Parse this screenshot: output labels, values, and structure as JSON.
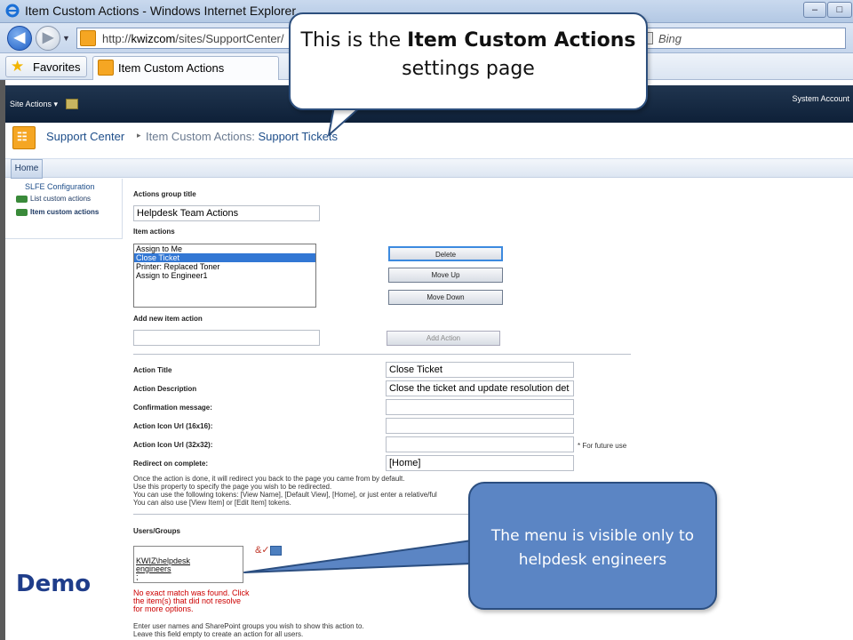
{
  "browser": {
    "window_title": "Item Custom Actions - Windows Internet Explorer",
    "address_prefix": "http://",
    "address_host": "kwizcom",
    "address_path": "/sites/SupportCenter/",
    "search_placeholder": "Bing",
    "favorites_label": "Favorites",
    "tab_title": "Item Custom Actions"
  },
  "sharepoint": {
    "site_actions": "Site Actions ▾",
    "user": "System Account",
    "breadcrumb": {
      "site": "Support Center",
      "page_prefix": "Item Custom Actions: ",
      "page_list": "Support Tickets"
    },
    "top_nav": {
      "home": "Home"
    },
    "quick_launch": {
      "heading": "SLFE Configuration",
      "items": [
        "List custom actions",
        "Item custom actions"
      ]
    }
  },
  "form": {
    "group_title_label": "Actions group title",
    "group_title_value": "Helpdesk Team Actions",
    "item_actions_label": "Item actions",
    "item_actions": [
      "Assign to Me",
      "Close Ticket",
      "Printer: Replaced Toner",
      "Assign to Engineer1"
    ],
    "selected_action": "Close Ticket",
    "buttons": {
      "delete": "Delete",
      "move_up": "Move Up",
      "move_down": "Move Down",
      "add_action": "Add Action"
    },
    "add_new_label": "Add new item action",
    "fields": {
      "action_title": {
        "label": "Action Title",
        "value": "Close Ticket"
      },
      "action_description": {
        "label": "Action Description",
        "value": "Close the ticket and update resolution det"
      },
      "confirmation": {
        "label": "Confirmation message:",
        "value": ""
      },
      "icon16": {
        "label": "Action Icon Url (16x16):",
        "value": ""
      },
      "icon32": {
        "label": "Action Icon Url (32x32):",
        "value": "",
        "note": "* For future use"
      },
      "redirect": {
        "label": "Redirect on complete:",
        "value": "[Home]"
      }
    },
    "redirect_help": [
      "Once the action is done, it will redirect you back to the page you came from by default.",
      "Use this property to specify the page you wish to be redirected.",
      "You can use the following tokens: [View Name], [Default View], [Home], or just enter a relative/ful",
      "You can also use [View Item] or [Edit Item] tokens."
    ],
    "users_groups_label": "Users/Groups",
    "people_value_line1": "KWIZ\\helpdesk",
    "people_value_line2": "engineers",
    "people_value_line3": ";",
    "error_lines": [
      "No exact match was found. Click",
      "the item(s) that did not resolve",
      "for more options."
    ],
    "people_help": [
      "Enter user names and SharePoint groups you wish to show this action to.",
      "Leave this field empty to create an action for all users."
    ]
  },
  "slide": {
    "demo_label": "Demo",
    "callout_top_line1_pre": "This is the ",
    "callout_top_line1_bold": "Item Custom Actions",
    "callout_top_line2": "settings page",
    "callout_bottom_line1": "The menu is visible only to",
    "callout_bottom_line2": "helpdesk engineers"
  },
  "colors": {
    "callout_blue": "#5b85c4",
    "selected_row": "#3277d4",
    "error_red": "#cc0000",
    "demo_blue": "#1f3d8a"
  }
}
